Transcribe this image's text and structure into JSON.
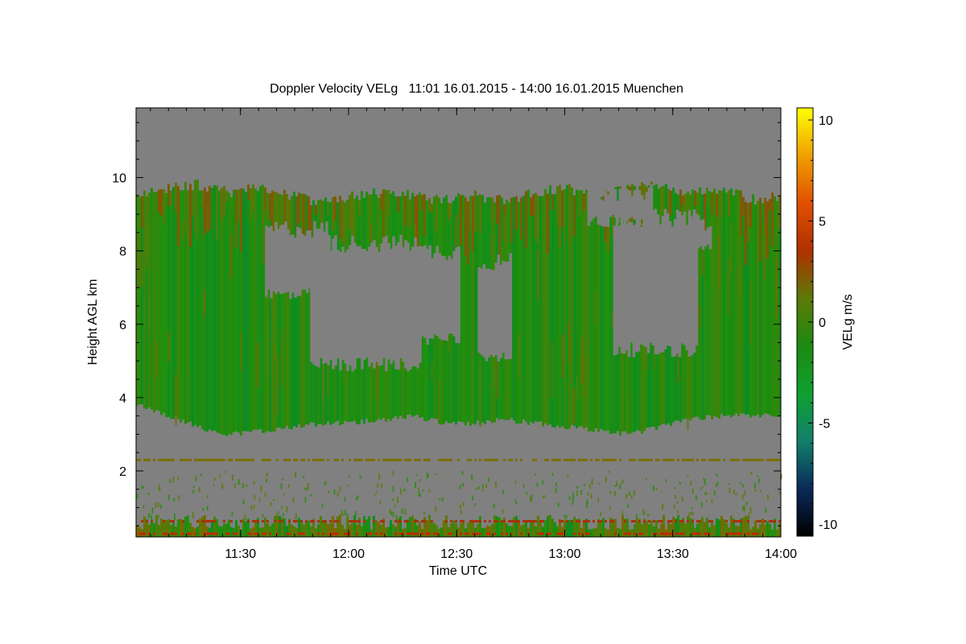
{
  "chart_data": {
    "type": "heatmap",
    "title": "Doppler Velocity VELg   11:01 16.01.2015 - 14:00 16.01.2015 Muenchen",
    "xlabel": "Time UTC",
    "ylabel": "Height AGL km",
    "colorbar_label": "VELg m/s",
    "x_ticks": [
      "11:30",
      "12:00",
      "12:30",
      "13:00",
      "13:30",
      "14:00"
    ],
    "x_tick_minutes": [
      29,
      59,
      89,
      119,
      149,
      179
    ],
    "xlim_minutes": [
      0,
      179
    ],
    "y_ticks": [
      2,
      4,
      6,
      8,
      10
    ],
    "ylim": [
      0.2,
      11.9
    ],
    "colorbar_ticks": [
      10,
      5,
      0,
      -5,
      -10
    ],
    "colorbar_range": [
      -10.6,
      10.6
    ],
    "colormap": [
      "#000000",
      "#0a2a5a",
      "#12806a",
      "#10a030",
      "#1c8a10",
      "#5c7a08",
      "#b03000",
      "#e05000",
      "#f0a000",
      "#ffff00"
    ],
    "no_data_color": "#808080",
    "regions": {
      "cloud_top_km": [
        9.5,
        9.7,
        9.8,
        9.6,
        9.7,
        9.5,
        9.3,
        9.5,
        9.6,
        9.5,
        9.4,
        9.5,
        9.4,
        9.6,
        9.7,
        9.5,
        9.7,
        9.8,
        9.6,
        9.7,
        9.4,
        9.5
      ],
      "cloud_base_km": [
        3.8,
        3.5,
        3.2,
        3.0,
        3.1,
        3.2,
        3.3,
        3.3,
        3.4,
        3.5,
        3.3,
        3.3,
        3.4,
        3.3,
        3.2,
        3.1,
        3.0,
        3.2,
        3.4,
        3.5,
        3.5,
        3.5
      ],
      "gap_band_km": [
        4.8,
        8.3
      ],
      "thin_layer_km": 2.3,
      "surface_layer_km": [
        0.2,
        0.8
      ]
    }
  }
}
